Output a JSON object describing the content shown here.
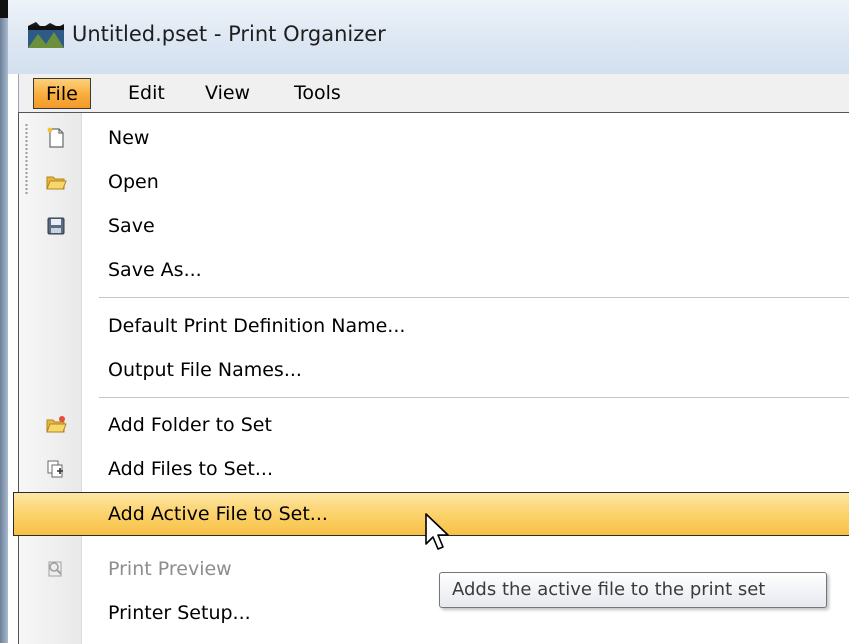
{
  "window": {
    "title": "Untitled.pset - Print Organizer"
  },
  "menubar": {
    "items": [
      {
        "label": "File",
        "active": true
      },
      {
        "label": "Edit",
        "active": false
      },
      {
        "label": "View",
        "active": false
      },
      {
        "label": "Tools",
        "active": false
      }
    ]
  },
  "file_menu": {
    "items": [
      {
        "label": "New",
        "icon": "new-file-icon",
        "enabled": true
      },
      {
        "label": "Open",
        "icon": "open-folder-icon",
        "enabled": true
      },
      {
        "label": "Save",
        "icon": "save-disk-icon",
        "enabled": true
      },
      {
        "label": "Save As...",
        "icon": null,
        "enabled": true
      },
      {
        "label": "Default Print Definition Name...",
        "icon": null,
        "enabled": true
      },
      {
        "label": "Output File Names...",
        "icon": null,
        "enabled": true
      },
      {
        "label": "Add Folder to Set",
        "icon": "add-folder-icon",
        "enabled": true
      },
      {
        "label": "Add Files to Set...",
        "icon": "add-files-icon",
        "enabled": true
      },
      {
        "label": "Add Active File to Set...",
        "icon": null,
        "enabled": true,
        "highlighted": true
      },
      {
        "label": "Print Preview",
        "icon": "print-preview-icon",
        "enabled": false
      },
      {
        "label": "Printer Setup...",
        "icon": null,
        "enabled": true
      }
    ]
  },
  "tooltip": {
    "text": "Adds the active file to the print set"
  },
  "colors": {
    "menu_active": "#f8ad3c",
    "highlight": "#fcd470",
    "titlebar": "#dde7f3",
    "disabled_text": "#8d8d8d"
  }
}
